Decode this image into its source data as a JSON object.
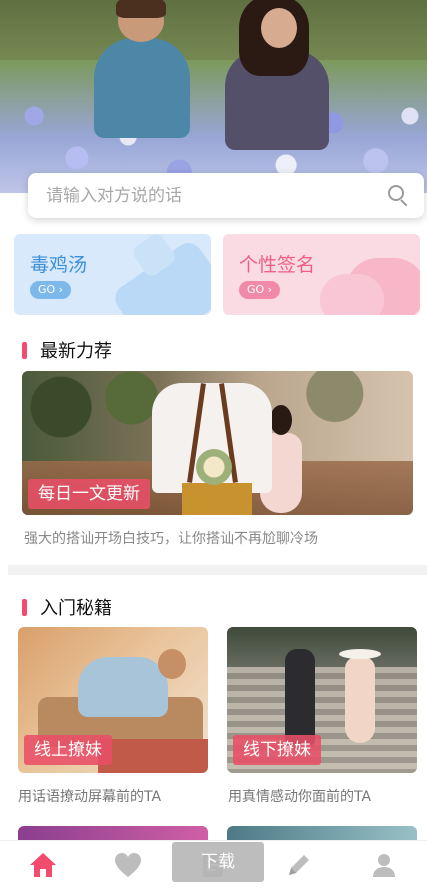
{
  "search": {
    "placeholder": "请输入对方说的话"
  },
  "categories": [
    {
      "title": "毒鸡汤",
      "go": "GO ›",
      "color": "#3d8fd8"
    },
    {
      "title": "个性签名",
      "go": "GO ›",
      "color": "#ee5f86"
    }
  ],
  "featured_section": {
    "title": "最新力荐",
    "badge": "每日一文更新",
    "description": "强大的搭讪开场白技巧，让你搭讪不再尬聊冷场"
  },
  "secrets_section": {
    "title": "入门秘籍",
    "cards": [
      {
        "badge": "线上撩妹",
        "description": "用话语撩动屏幕前的TA"
      },
      {
        "badge": "线下撩妹",
        "description": "用真情感动你面前的TA"
      }
    ]
  },
  "download_button": "下载",
  "nav": {
    "items": [
      "home-icon",
      "heart-icon",
      "document-icon",
      "pencil-icon",
      "user-icon"
    ],
    "active_color": "#f24b6e",
    "inactive_color": "#bdbdbd"
  },
  "colors": {
    "accent": "#f24b6e"
  }
}
